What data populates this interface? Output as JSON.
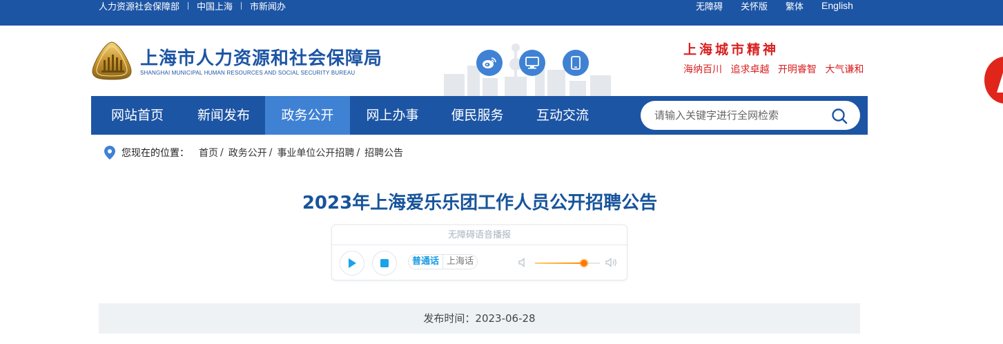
{
  "topbar": {
    "left_links": [
      "人力资源社会保障部",
      "中国上海",
      "市新闻办"
    ],
    "right_links": [
      "无障碍",
      "关怀版",
      "繁体"
    ],
    "english": "English"
  },
  "header": {
    "logo_cn": "上海市人力资源和社会保障局",
    "logo_en": "SHANGHAI MUNICIPAL HUMAN RESOURCES AND SOCIAL SECURITY BUREAU",
    "social_icons": [
      "weibo-icon",
      "monitor-icon",
      "mobile-icon"
    ],
    "spirit_title": "上海城市精神",
    "spirit_words": [
      "海纳百川",
      "追求卓越",
      "开明睿智",
      "大气谦和"
    ]
  },
  "nav": {
    "items": [
      "网站首页",
      "新闻发布",
      "政务公开",
      "网上办事",
      "便民服务",
      "互动交流"
    ],
    "active_index": 2,
    "search_placeholder": "请输入关键字进行全网检索"
  },
  "breadcrumb": {
    "lead": "您现在的位置：",
    "items": [
      "首页",
      "政务公开",
      "事业单位公开招聘",
      "招聘公告"
    ]
  },
  "article": {
    "title": "2023年上海爱乐乐团工作人员公开招聘公告",
    "publish_label": "发布时间：2023-06-28"
  },
  "player": {
    "title": "无障碍语音播报",
    "lang_active": "普通话",
    "lang_other": "上海话",
    "volume_level": 0.75
  },
  "colors": {
    "brand_blue": "#1d55a5",
    "active_blue": "#3f82d4",
    "spirit_red": "#d81e1e",
    "title_blue": "#17549b"
  }
}
